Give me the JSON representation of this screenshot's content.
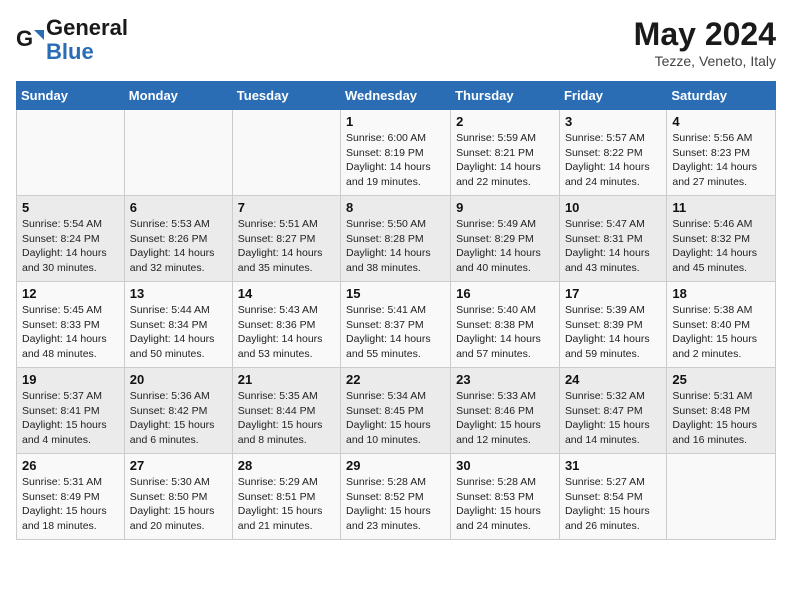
{
  "header": {
    "logo_line1": "General",
    "logo_line2": "Blue",
    "month": "May 2024",
    "location": "Tezze, Veneto, Italy"
  },
  "days_of_week": [
    "Sunday",
    "Monday",
    "Tuesday",
    "Wednesday",
    "Thursday",
    "Friday",
    "Saturday"
  ],
  "weeks": [
    [
      {
        "day": "",
        "info": ""
      },
      {
        "day": "",
        "info": ""
      },
      {
        "day": "",
        "info": ""
      },
      {
        "day": "1",
        "info": "Sunrise: 6:00 AM\nSunset: 8:19 PM\nDaylight: 14 hours\nand 19 minutes."
      },
      {
        "day": "2",
        "info": "Sunrise: 5:59 AM\nSunset: 8:21 PM\nDaylight: 14 hours\nand 22 minutes."
      },
      {
        "day": "3",
        "info": "Sunrise: 5:57 AM\nSunset: 8:22 PM\nDaylight: 14 hours\nand 24 minutes."
      },
      {
        "day": "4",
        "info": "Sunrise: 5:56 AM\nSunset: 8:23 PM\nDaylight: 14 hours\nand 27 minutes."
      }
    ],
    [
      {
        "day": "5",
        "info": "Sunrise: 5:54 AM\nSunset: 8:24 PM\nDaylight: 14 hours\nand 30 minutes."
      },
      {
        "day": "6",
        "info": "Sunrise: 5:53 AM\nSunset: 8:26 PM\nDaylight: 14 hours\nand 32 minutes."
      },
      {
        "day": "7",
        "info": "Sunrise: 5:51 AM\nSunset: 8:27 PM\nDaylight: 14 hours\nand 35 minutes."
      },
      {
        "day": "8",
        "info": "Sunrise: 5:50 AM\nSunset: 8:28 PM\nDaylight: 14 hours\nand 38 minutes."
      },
      {
        "day": "9",
        "info": "Sunrise: 5:49 AM\nSunset: 8:29 PM\nDaylight: 14 hours\nand 40 minutes."
      },
      {
        "day": "10",
        "info": "Sunrise: 5:47 AM\nSunset: 8:31 PM\nDaylight: 14 hours\nand 43 minutes."
      },
      {
        "day": "11",
        "info": "Sunrise: 5:46 AM\nSunset: 8:32 PM\nDaylight: 14 hours\nand 45 minutes."
      }
    ],
    [
      {
        "day": "12",
        "info": "Sunrise: 5:45 AM\nSunset: 8:33 PM\nDaylight: 14 hours\nand 48 minutes."
      },
      {
        "day": "13",
        "info": "Sunrise: 5:44 AM\nSunset: 8:34 PM\nDaylight: 14 hours\nand 50 minutes."
      },
      {
        "day": "14",
        "info": "Sunrise: 5:43 AM\nSunset: 8:36 PM\nDaylight: 14 hours\nand 53 minutes."
      },
      {
        "day": "15",
        "info": "Sunrise: 5:41 AM\nSunset: 8:37 PM\nDaylight: 14 hours\nand 55 minutes."
      },
      {
        "day": "16",
        "info": "Sunrise: 5:40 AM\nSunset: 8:38 PM\nDaylight: 14 hours\nand 57 minutes."
      },
      {
        "day": "17",
        "info": "Sunrise: 5:39 AM\nSunset: 8:39 PM\nDaylight: 14 hours\nand 59 minutes."
      },
      {
        "day": "18",
        "info": "Sunrise: 5:38 AM\nSunset: 8:40 PM\nDaylight: 15 hours\nand 2 minutes."
      }
    ],
    [
      {
        "day": "19",
        "info": "Sunrise: 5:37 AM\nSunset: 8:41 PM\nDaylight: 15 hours\nand 4 minutes."
      },
      {
        "day": "20",
        "info": "Sunrise: 5:36 AM\nSunset: 8:42 PM\nDaylight: 15 hours\nand 6 minutes."
      },
      {
        "day": "21",
        "info": "Sunrise: 5:35 AM\nSunset: 8:44 PM\nDaylight: 15 hours\nand 8 minutes."
      },
      {
        "day": "22",
        "info": "Sunrise: 5:34 AM\nSunset: 8:45 PM\nDaylight: 15 hours\nand 10 minutes."
      },
      {
        "day": "23",
        "info": "Sunrise: 5:33 AM\nSunset: 8:46 PM\nDaylight: 15 hours\nand 12 minutes."
      },
      {
        "day": "24",
        "info": "Sunrise: 5:32 AM\nSunset: 8:47 PM\nDaylight: 15 hours\nand 14 minutes."
      },
      {
        "day": "25",
        "info": "Sunrise: 5:31 AM\nSunset: 8:48 PM\nDaylight: 15 hours\nand 16 minutes."
      }
    ],
    [
      {
        "day": "26",
        "info": "Sunrise: 5:31 AM\nSunset: 8:49 PM\nDaylight: 15 hours\nand 18 minutes."
      },
      {
        "day": "27",
        "info": "Sunrise: 5:30 AM\nSunset: 8:50 PM\nDaylight: 15 hours\nand 20 minutes."
      },
      {
        "day": "28",
        "info": "Sunrise: 5:29 AM\nSunset: 8:51 PM\nDaylight: 15 hours\nand 21 minutes."
      },
      {
        "day": "29",
        "info": "Sunrise: 5:28 AM\nSunset: 8:52 PM\nDaylight: 15 hours\nand 23 minutes."
      },
      {
        "day": "30",
        "info": "Sunrise: 5:28 AM\nSunset: 8:53 PM\nDaylight: 15 hours\nand 24 minutes."
      },
      {
        "day": "31",
        "info": "Sunrise: 5:27 AM\nSunset: 8:54 PM\nDaylight: 15 hours\nand 26 minutes."
      },
      {
        "day": "",
        "info": ""
      }
    ]
  ]
}
